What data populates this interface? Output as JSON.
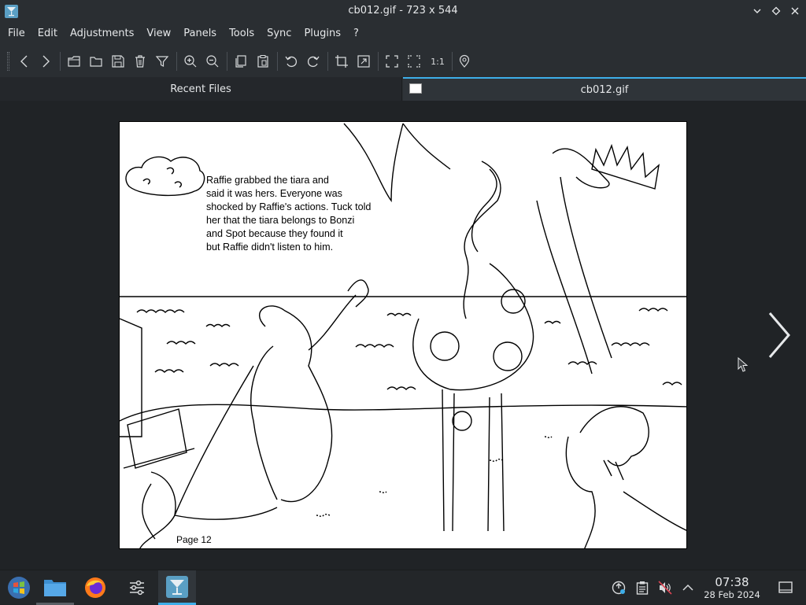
{
  "window": {
    "title": "cb012.gif - 723 x 544",
    "app_icon": "cocktail-glass-icon"
  },
  "menu": [
    "File",
    "Edit",
    "Adjustments",
    "View",
    "Panels",
    "Tools",
    "Sync",
    "Plugins",
    "?"
  ],
  "toolbar": {
    "icons": [
      "back-arrow-icon",
      "forward-arrow-icon",
      "open-file-icon",
      "open-folder-icon",
      "save-icon",
      "delete-icon",
      "filter-icon",
      "zoom-in-icon",
      "zoom-out-icon",
      "copy-icon",
      "paste-icon",
      "rotate-left-icon",
      "rotate-right-icon",
      "crop-icon",
      "resize-icon",
      "fullscreen-icon",
      "fit-window-icon",
      "actual-size-icon",
      "location-pin-icon"
    ],
    "actual_size_label": "1:1"
  },
  "tabs": {
    "recent_label": "Recent Files",
    "active_label": "cb012.gif"
  },
  "image": {
    "story_lines": [
      "Raffie grabbed the tiara and",
      "said it was hers. Everyone was",
      "shocked by Raffie's actions. Tuck told",
      "her that the tiara belongs to Bonzi",
      "and Spot because they found it",
      "but Raffie didn't listen to him."
    ],
    "page_label": "Page 12"
  },
  "taskbar": {
    "apps": [
      "start-menu-icon",
      "file-manager-icon",
      "firefox-icon",
      "settings-mixer-icon",
      "image-viewer-icon"
    ],
    "tray": [
      "update-icon",
      "clipboard-icon",
      "volume-muted-icon",
      "chevron-up-icon"
    ],
    "time": "07:38",
    "date": "28 Feb 2024",
    "show_desktop": "show-desktop-icon"
  },
  "colors": {
    "accent": "#3daee9",
    "titlebar_bg": "#2a2e32",
    "viewer_bg": "#202326"
  }
}
